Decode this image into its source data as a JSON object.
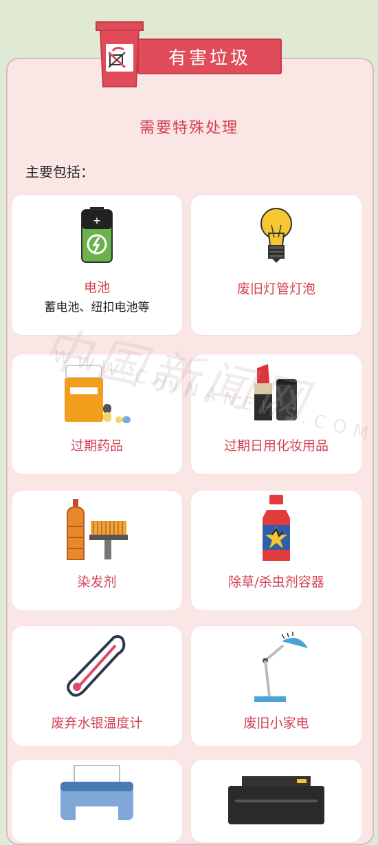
{
  "header": {
    "title": "有害垃圾",
    "subtitle": "需要特殊处理",
    "intro": "主要包括："
  },
  "items": [
    {
      "label": "电池",
      "note": "蓄电池、纽扣电池等",
      "icon": "battery-icon"
    },
    {
      "label": "废旧灯管灯泡",
      "icon": "light-bulb-icon"
    },
    {
      "label": "过期药品",
      "icon": "medicine-bottle-icon"
    },
    {
      "label": "过期日用化妆用品",
      "icon": "lipstick-icon"
    },
    {
      "label": "染发剂",
      "icon": "hair-dye-icon"
    },
    {
      "label": "除草/杀虫剂容器",
      "icon": "pesticide-bottle-icon"
    },
    {
      "label": "废弃水银温度计",
      "icon": "thermometer-icon"
    },
    {
      "label": "废旧小家电",
      "icon": "desk-lamp-icon"
    },
    {
      "label": "",
      "icon": "printer-icon"
    },
    {
      "label": "",
      "icon": "toner-cartridge-icon"
    }
  ],
  "watermark": {
    "cn": "中国新闻网",
    "en": "WWW.CHINANEWS.COM"
  },
  "colors": {
    "accent": "#d24253",
    "banner": "#e04c59",
    "panel": "#fbe6e6",
    "background": "#dfe9d3"
  }
}
